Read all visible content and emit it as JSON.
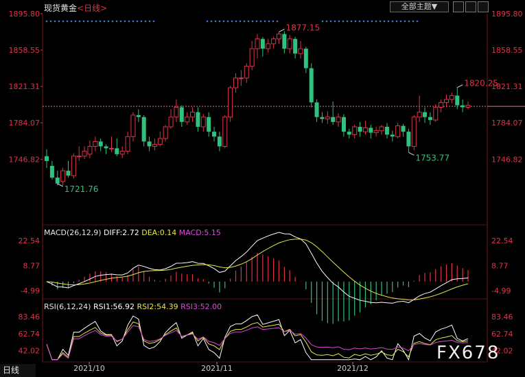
{
  "header": {
    "instrument": "现货黄金",
    "period_label": "<日线>",
    "theme_button": "全部主题▼"
  },
  "footer": {
    "period_button": "日线",
    "watermark": "FX678"
  },
  "colors": {
    "up": "#e0344a",
    "down": "#2ec27e",
    "grid": "#7a1a1a",
    "diff": "#ffffff",
    "dea": "#e8e84a",
    "rsi1": "#ffffff",
    "rsi2": "#e8e84a",
    "rsi3": "#d94bd9",
    "dots": "#3d7bd6"
  },
  "macd": {
    "name": "MACD(26,12,9)",
    "diff": "DIFF:2.72",
    "dea": "DEA:0.14",
    "macd": "MACD:5.15"
  },
  "rsi": {
    "name": "RSI(6,12,24)",
    "rsi1": "RSI1:56.92",
    "rsi2": "RSI2:54.39",
    "rsi3": "RSI3:52.00"
  },
  "chart_data": [
    {
      "type": "candlestick",
      "title": "现货黄金 日线",
      "y_ticks": [
        "1895.80",
        "1858.55",
        "1821.31",
        "1784.07",
        "1746.82"
      ],
      "ylim": [
        1721.76,
        1895.8
      ],
      "x_ticks": [
        "2021/10",
        "2021/11",
        "2021/12"
      ],
      "current_price_line": 1801,
      "annotations": [
        {
          "text": "1877.15",
          "value": 1877.15,
          "color": "up"
        },
        {
          "text": "1721.76",
          "value": 1721.76,
          "color": "down"
        },
        {
          "text": "1753.77",
          "value": 1753.77,
          "color": "down"
        },
        {
          "text": "1820.25",
          "value": 1820.25,
          "color": "up"
        }
      ],
      "candles": [
        [
          1750,
          1745,
          1757,
          1738
        ],
        [
          1740,
          1728,
          1745,
          1726
        ],
        [
          1728,
          1722,
          1735,
          1720
        ],
        [
          1724,
          1735,
          1738,
          1720
        ],
        [
          1735,
          1730,
          1745,
          1728
        ],
        [
          1730,
          1750,
          1753,
          1727
        ],
        [
          1750,
          1750,
          1760,
          1745
        ],
        [
          1750,
          1755,
          1760,
          1747
        ],
        [
          1752,
          1760,
          1766,
          1748
        ],
        [
          1760,
          1765,
          1770,
          1755
        ],
        [
          1765,
          1760,
          1768,
          1755
        ],
        [
          1760,
          1758,
          1762,
          1752
        ],
        [
          1758,
          1758,
          1770,
          1754
        ],
        [
          1758,
          1752,
          1768,
          1750
        ],
        [
          1752,
          1755,
          1760,
          1748
        ],
        [
          1755,
          1770,
          1775,
          1752
        ],
        [
          1770,
          1792,
          1795,
          1765
        ],
        [
          1792,
          1790,
          1798,
          1785
        ],
        [
          1790,
          1765,
          1792,
          1760
        ],
        [
          1765,
          1760,
          1770,
          1755
        ],
        [
          1760,
          1762,
          1768,
          1756
        ],
        [
          1762,
          1768,
          1775,
          1760
        ],
        [
          1768,
          1780,
          1782,
          1765
        ],
        [
          1780,
          1790,
          1798,
          1778
        ],
        [
          1790,
          1800,
          1808,
          1785
        ],
        [
          1800,
          1785,
          1802,
          1780
        ],
        [
          1785,
          1790,
          1795,
          1782
        ],
        [
          1790,
          1795,
          1800,
          1785
        ],
        [
          1795,
          1780,
          1800,
          1775
        ],
        [
          1780,
          1790,
          1793,
          1775
        ],
        [
          1790,
          1775,
          1795,
          1770
        ],
        [
          1775,
          1770,
          1780,
          1765
        ],
        [
          1770,
          1760,
          1775,
          1755
        ],
        [
          1760,
          1790,
          1792,
          1758
        ],
        [
          1790,
          1820,
          1822,
          1785
        ],
        [
          1820,
          1830,
          1835,
          1815
        ],
        [
          1830,
          1830,
          1838,
          1822
        ],
        [
          1830,
          1842,
          1845,
          1825
        ],
        [
          1842,
          1860,
          1868,
          1838
        ],
        [
          1860,
          1870,
          1875,
          1850
        ],
        [
          1870,
          1860,
          1872,
          1852
        ],
        [
          1860,
          1865,
          1870,
          1856
        ],
        [
          1865,
          1870,
          1872,
          1860
        ],
        [
          1870,
          1875,
          1877,
          1865
        ],
        [
          1875,
          1860,
          1878,
          1855
        ],
        [
          1860,
          1870,
          1874,
          1855
        ],
        [
          1870,
          1855,
          1872,
          1850
        ],
        [
          1855,
          1860,
          1868,
          1850
        ],
        [
          1860,
          1840,
          1862,
          1835
        ],
        [
          1840,
          1805,
          1845,
          1800
        ],
        [
          1805,
          1790,
          1808,
          1785
        ],
        [
          1790,
          1788,
          1795,
          1784
        ],
        [
          1788,
          1790,
          1796,
          1783
        ],
        [
          1790,
          1785,
          1806,
          1782
        ],
        [
          1785,
          1790,
          1794,
          1780
        ],
        [
          1790,
          1775,
          1793,
          1770
        ],
        [
          1775,
          1772,
          1778,
          1768
        ],
        [
          1772,
          1780,
          1782,
          1768
        ],
        [
          1780,
          1775,
          1785,
          1770
        ],
        [
          1775,
          1779,
          1786,
          1772
        ],
        [
          1779,
          1774,
          1782,
          1768
        ],
        [
          1774,
          1776,
          1780,
          1770
        ],
        [
          1776,
          1780,
          1782,
          1772
        ],
        [
          1780,
          1772,
          1784,
          1768
        ],
        [
          1772,
          1770,
          1776,
          1765
        ],
        [
          1770,
          1781,
          1784,
          1768
        ],
        [
          1781,
          1775,
          1783,
          1770
        ],
        [
          1775,
          1760,
          1778,
          1753.77
        ],
        [
          1760,
          1790,
          1792,
          1756
        ],
        [
          1790,
          1795,
          1812,
          1785
        ],
        [
          1795,
          1790,
          1800,
          1784
        ],
        [
          1790,
          1787,
          1795,
          1782
        ],
        [
          1787,
          1800,
          1803,
          1785
        ],
        [
          1800,
          1805,
          1808,
          1795
        ],
        [
          1805,
          1808,
          1813,
          1800
        ],
        [
          1808,
          1812,
          1815,
          1804
        ],
        [
          1812,
          1802,
          1820.25,
          1798
        ],
        [
          1802,
          1800,
          1808,
          1795
        ],
        [
          1800,
          1802,
          1806,
          1798
        ]
      ]
    },
    {
      "type": "macd",
      "y_ticks": [
        "22.54",
        "8.77",
        "-4.99"
      ],
      "ylim": [
        -8,
        26
      ]
    },
    {
      "type": "rsi",
      "y_ticks": [
        "83.46",
        "62.74",
        "42.02"
      ],
      "ylim": [
        30,
        92
      ]
    }
  ]
}
